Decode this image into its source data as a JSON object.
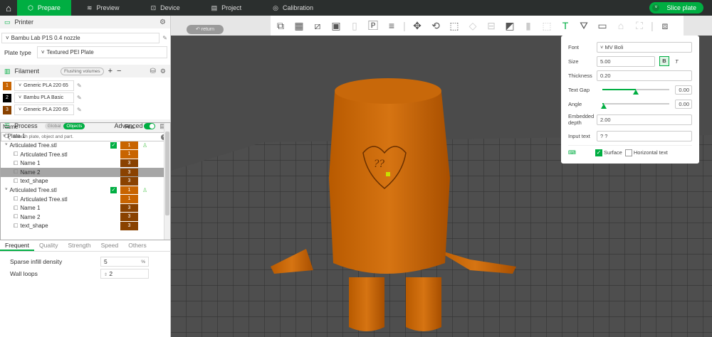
{
  "topbar": {
    "tabs": [
      "Prepare",
      "Preview",
      "Device",
      "Project",
      "Calibration"
    ],
    "slice_label": "Slice plate"
  },
  "printer": {
    "title": "Printer",
    "preset": "Bambu Lab P1S 0.4 nozzle",
    "plate_type_label": "Plate type",
    "plate_type": "Textured PEI Plate"
  },
  "filament": {
    "title": "Filament",
    "flushing_label": "Flushing volumes",
    "items": [
      {
        "num": "1",
        "name": "Generic PLA 220 65",
        "color": "#c86400"
      },
      {
        "num": "2",
        "name": "Bambu PLA Basic",
        "color": "#000000"
      },
      {
        "num": "3",
        "name": "Generic PLA 220 65",
        "color": "#8a4200"
      }
    ]
  },
  "process": {
    "title": "Process",
    "global_label": "Global",
    "objects_label": "Objects",
    "advanced_label": "Advanced",
    "search_placeholder": "Search plate, object and part.",
    "col_name": "Name",
    "col_fila": "Fila.",
    "rows": [
      {
        "name": "Plate 1",
        "level": 0
      },
      {
        "name": "Articulated Tree.stl",
        "level": 1,
        "fila": "1",
        "obj": true
      },
      {
        "name": "Articulated Tree.stl",
        "level": 2,
        "fila": "1"
      },
      {
        "name": "Name 1",
        "level": 2,
        "fila": "3"
      },
      {
        "name": "Name 2",
        "level": 2,
        "fila": "3",
        "selected": true
      },
      {
        "name": "text_shape",
        "level": 2,
        "fila": "3"
      },
      {
        "name": "Articulated Tree.stl",
        "level": 1,
        "fila": "1",
        "obj": true
      },
      {
        "name": "Articulated Tree.stl",
        "level": 2,
        "fila": "1"
      },
      {
        "name": "Name 1",
        "level": 2,
        "fila": "3"
      },
      {
        "name": "Name 2",
        "level": 2,
        "fila": "3"
      },
      {
        "name": "text_shape",
        "level": 2,
        "fila": "3"
      }
    ],
    "tabs": [
      "Frequent",
      "Quality",
      "Strength",
      "Speed",
      "Others"
    ],
    "sparse_label": "Sparse infill density",
    "sparse_value": "5",
    "sparse_unit": "%",
    "wall_label": "Wall loops",
    "wall_value": "2"
  },
  "viewport": {
    "return_label": "return"
  },
  "text_panel": {
    "font_label": "Font",
    "font": "MV Boli",
    "size_label": "Size",
    "size": "5.00",
    "bold": "B",
    "italic": "T",
    "thickness_label": "Thickness",
    "thickness": "0.20",
    "gap_label": "Text Gap",
    "gap": "0.00",
    "gap_fraction": 0.5,
    "angle_label": "Angle",
    "angle": "0.00",
    "angle_fraction": 0.02,
    "depth_label": "Embedded depth",
    "depth": "2.00",
    "input_label": "Input text",
    "input": "? ?",
    "surface_label": "Surface",
    "horizontal_label": "Horizontal text"
  },
  "colors": {
    "accent": "#00ae42",
    "fila1": "#c86400",
    "fila3": "#8a4200"
  }
}
